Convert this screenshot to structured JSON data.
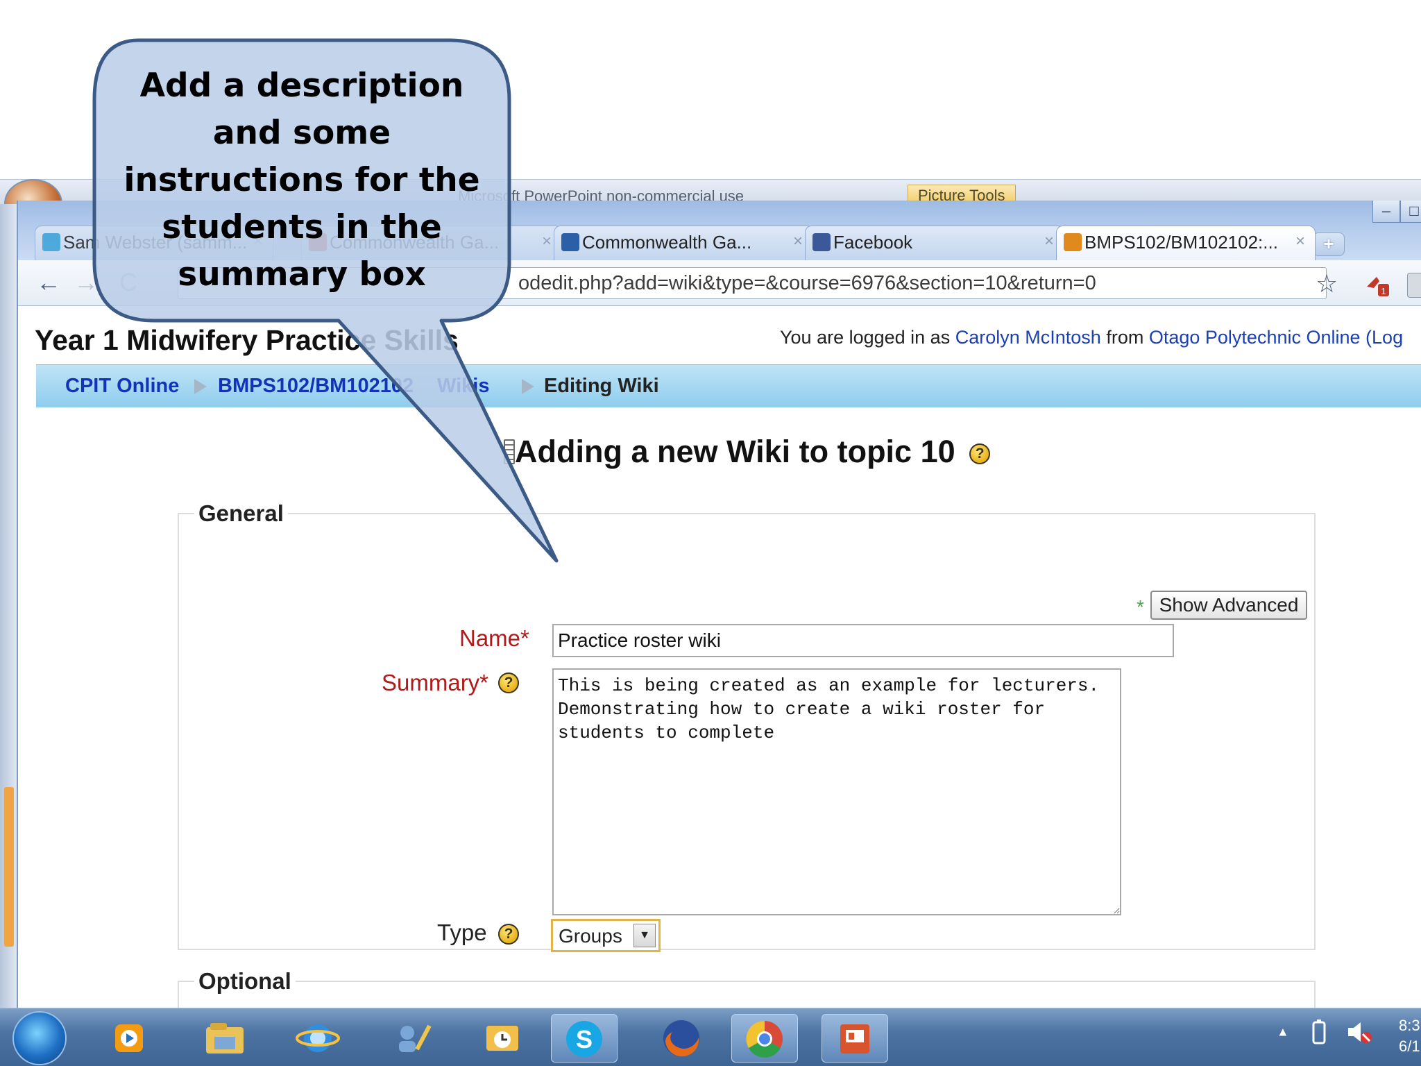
{
  "powerpoint": {
    "title": "Microsoft PowerPoint non-commercial use",
    "picture_tools": "Picture Tools"
  },
  "browser": {
    "tabs": [
      {
        "label": "Sam Webster (samm...",
        "icon": "twitter-bird-icon"
      },
      {
        "label": "Commonwealth Ga...",
        "icon": "commonwealth-games-icon"
      },
      {
        "label": "Commonwealth Ga...",
        "icon": "commonwealth-games-icon"
      },
      {
        "label": "Facebook",
        "icon": "facebook-icon"
      },
      {
        "label": "BMPS102/BM102102:...",
        "icon": "moodle-icon"
      }
    ],
    "tab_close": "×",
    "new_tab": "+",
    "url_text": "odedit.php?add=wiki&type=&course=6976&section=10&return=0",
    "back": "←",
    "forward": "→",
    "reload": "C",
    "star": "☆"
  },
  "page": {
    "site_title": "Year 1 Midwifery Practice Skills",
    "login_prefix": "You are logged in as",
    "login_user": "Carolyn McIntosh",
    "login_from": "from",
    "login_org": "Otago Polytechnic Online",
    "login_suffix": "(Log",
    "breadcrumbs": [
      "CPIT Online",
      "BMPS102/BM102102",
      "Wikis",
      "Editing Wiki"
    ],
    "heading": "Adding a new Wiki to topic 10",
    "help_glyph": "?",
    "general_legend": "General",
    "required_star": "*",
    "show_advanced": "Show Advanced",
    "name_label": "Name*",
    "name_value": "Practice roster wiki",
    "summary_label": "Summary*",
    "summary_value": "This is being created as an example for lecturers. Demonstrating how to create a wiki roster for students to complete",
    "type_label": "Type",
    "type_value": "Groups",
    "optional_legend": "Optional"
  },
  "taskbar": {
    "tray": "▲",
    "clock_time": "8:3",
    "clock_date": "6/1"
  },
  "callout": {
    "text": "Add a description and some instructions for the students in the summary box"
  },
  "colors": {
    "callout_fill": "#b9cde8",
    "callout_border": "#3b5a86",
    "breadcrumb_bar": "#a6d6f1",
    "required_label": "#b01a1a",
    "link": "#1a3fb6"
  }
}
